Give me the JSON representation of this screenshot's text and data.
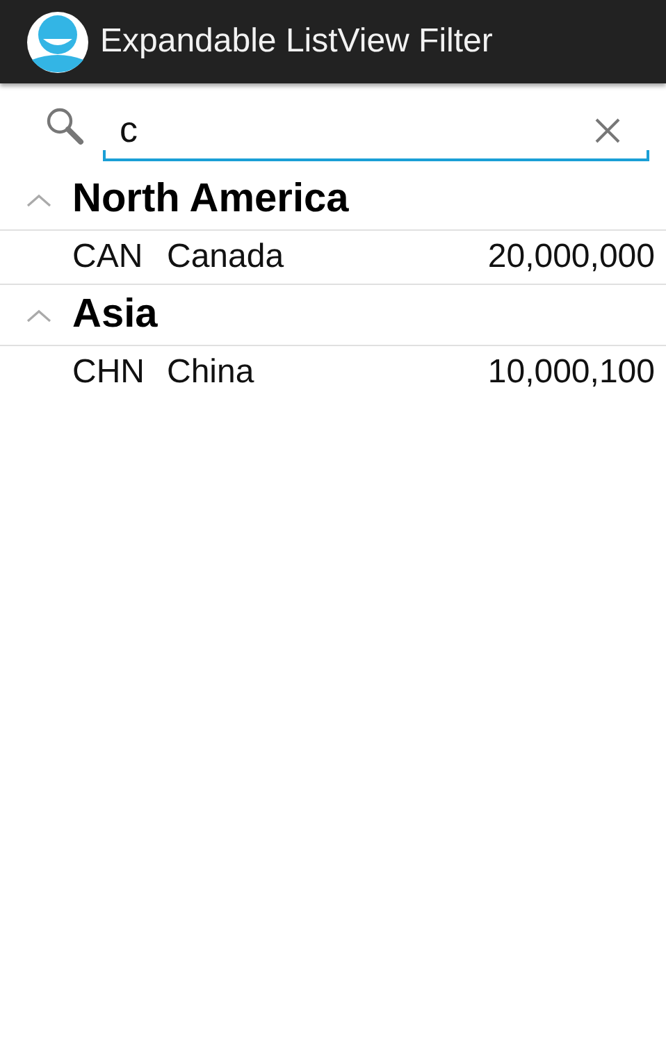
{
  "action_bar": {
    "title": "Expandable ListView Filter"
  },
  "search": {
    "value": "c"
  },
  "groups": [
    {
      "name": "North America",
      "expanded": true,
      "children": [
        {
          "code": "CAN",
          "name": "Canada",
          "population": "20,000,000"
        }
      ]
    },
    {
      "name": "Asia",
      "expanded": true,
      "children": [
        {
          "code": "CHN",
          "name": "China",
          "population": "10,000,100"
        }
      ]
    }
  ]
}
